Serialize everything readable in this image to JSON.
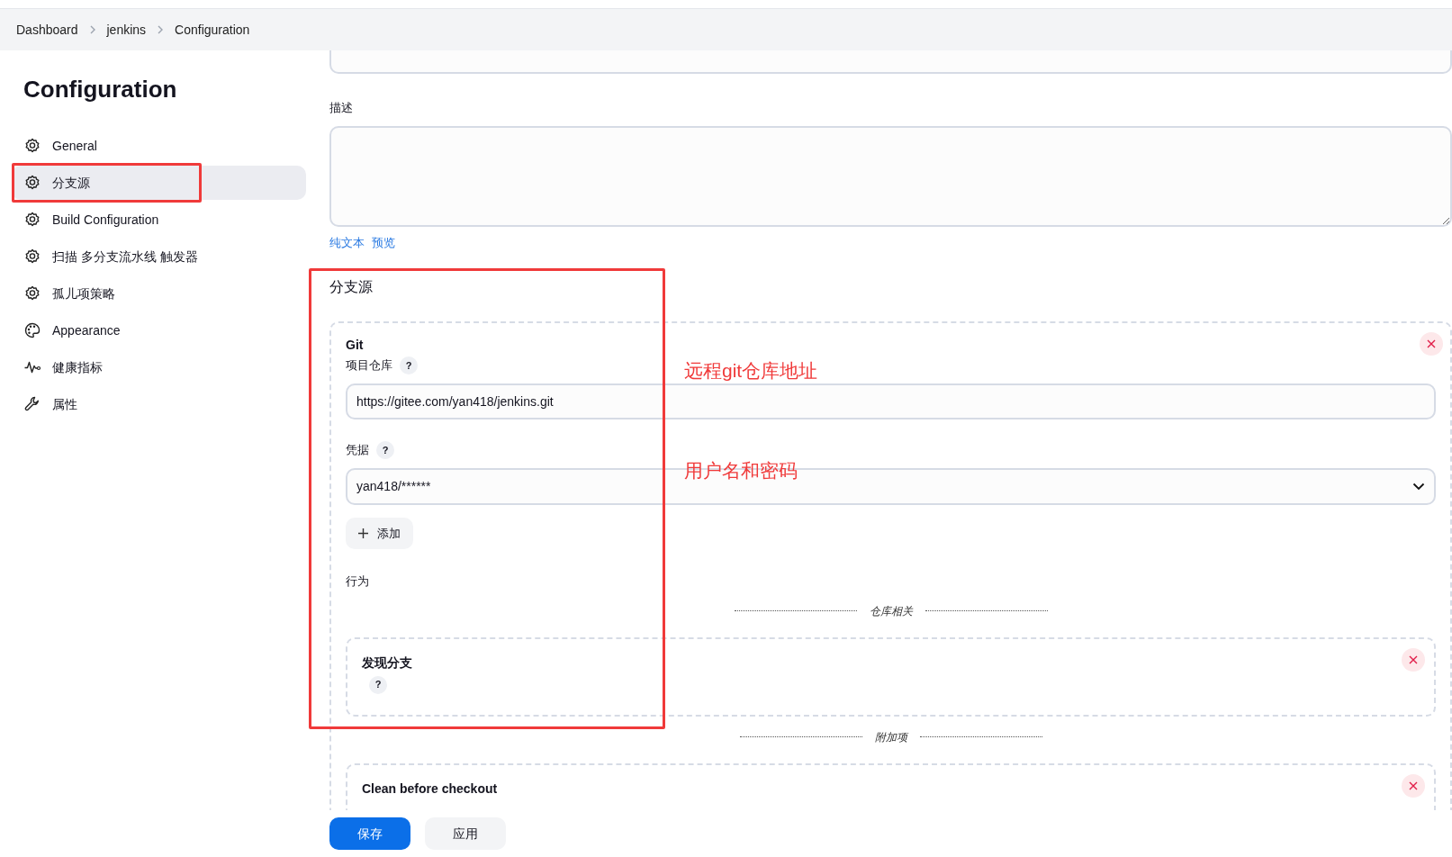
{
  "breadcrumbs": [
    {
      "label": "Dashboard"
    },
    {
      "label": "jenkins"
    },
    {
      "label": "Configuration"
    }
  ],
  "sidebar": {
    "title": "Configuration",
    "items": [
      {
        "label": "General",
        "kind": "gear",
        "selected": false
      },
      {
        "label": "分支源",
        "kind": "gear",
        "selected": true
      },
      {
        "label": "Build Configuration",
        "kind": "gear",
        "selected": false
      },
      {
        "label": "扫描 多分支流水线 触发器",
        "kind": "gear",
        "selected": false
      },
      {
        "label": "孤儿项策略",
        "kind": "gear",
        "selected": false
      },
      {
        "label": "Appearance",
        "kind": "palette",
        "selected": false
      },
      {
        "label": "健康指标",
        "kind": "pulse",
        "selected": false
      },
      {
        "label": "属性",
        "kind": "wrench",
        "selected": false
      }
    ]
  },
  "description": {
    "label": "描述",
    "links": [
      "纯文本",
      "预览"
    ]
  },
  "branch_sources": {
    "title": "分支源",
    "source": {
      "title": "Git",
      "repo_label": "项目仓库",
      "repo_help": "?",
      "repo_value": "https://gitee.com/yan418/jenkins.git",
      "cred_label": "凭据",
      "cred_help": "?",
      "cred_value": "yan418/******",
      "add_button": "添加",
      "behaviours_label": "行为",
      "groups": [
        {
          "heading": "仓库相关",
          "cards": [
            {
              "title": "发现分支",
              "help": "?"
            }
          ]
        },
        {
          "heading": "附加项",
          "cards": [
            {
              "title": "Clean before checkout"
            }
          ]
        }
      ]
    }
  },
  "actions": {
    "save": "保存",
    "apply": "应用"
  },
  "annotations": [
    {
      "text": "远程git仓库地址"
    },
    {
      "text": "用户名和密码"
    }
  ]
}
